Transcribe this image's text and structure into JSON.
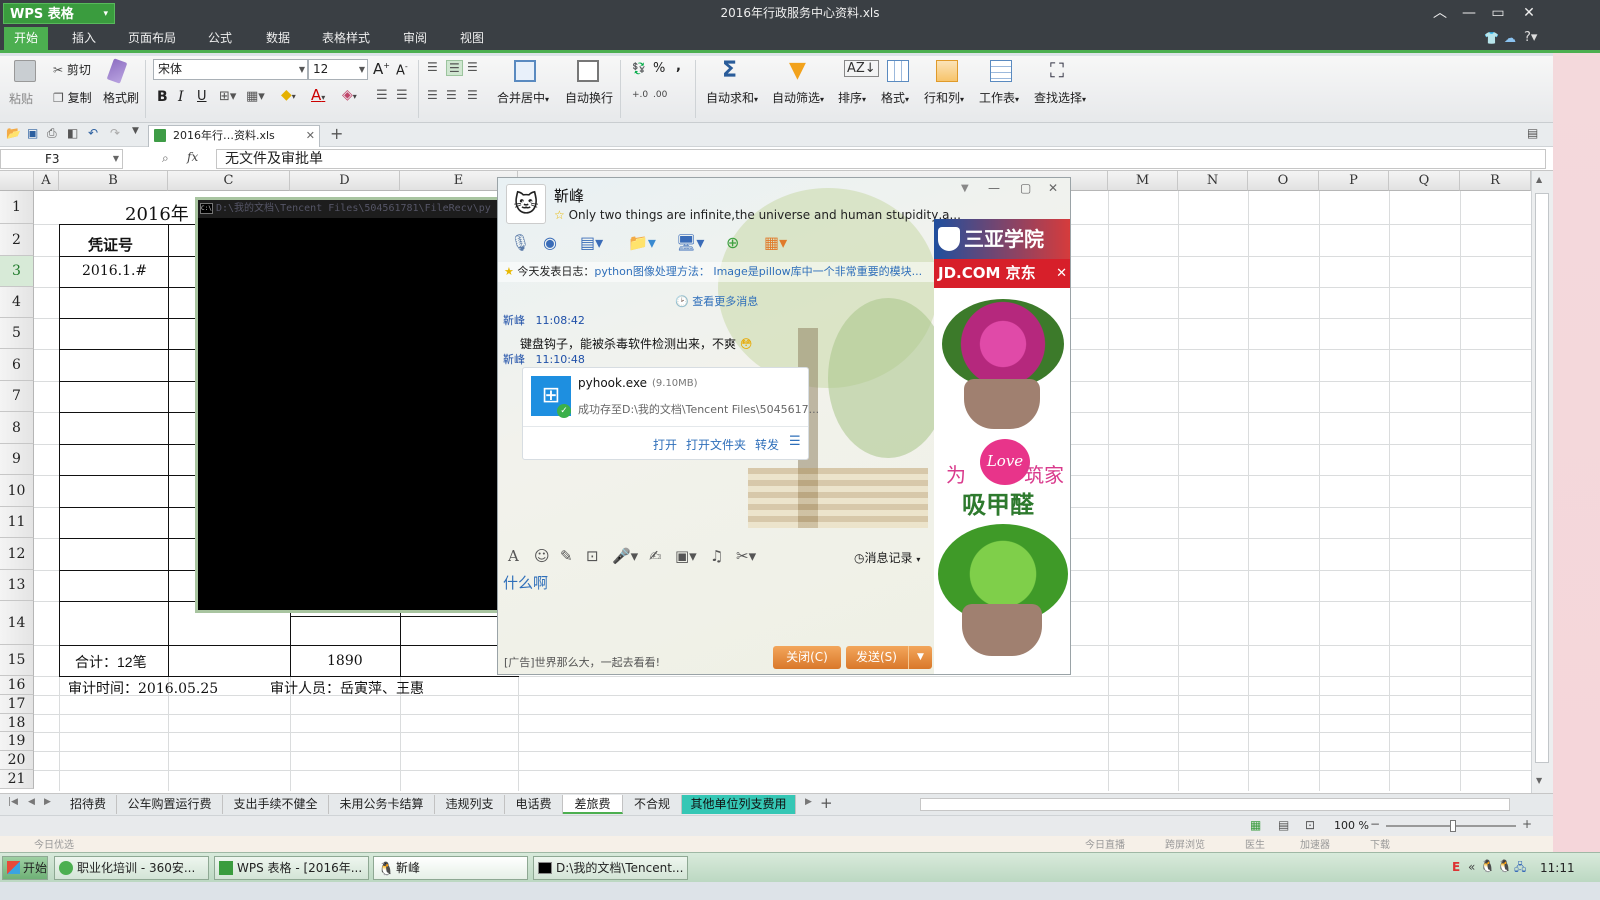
{
  "app": {
    "logo": "WPS 表格",
    "title": "2016年行政服务中心资料.xls"
  },
  "menu": [
    "开始",
    "插入",
    "页面布局",
    "公式",
    "数据",
    "表格样式",
    "审阅",
    "视图"
  ],
  "ribbon": {
    "paste": "粘贴",
    "cut": "剪切",
    "copy": "复制",
    "format_painter": "格式刷",
    "font_name": "宋体",
    "font_size": "12",
    "merge_center": "合并居中",
    "wrap": "自动换行",
    "autosum": "自动求和",
    "autofilter": "自动筛选",
    "sort": "排序",
    "format": "格式",
    "rows_cols": "行和列",
    "worksheet": "工作表",
    "find_select": "查找选择",
    "percent": "%",
    "comma": ","
  },
  "doc_tab": "2016年行…资料.xls",
  "formula_bar": {
    "cell_ref": "F3",
    "fx": "fx",
    "content": "无文件及审批单"
  },
  "columns": [
    "A",
    "B",
    "C",
    "D",
    "E",
    "M",
    "N",
    "O",
    "P",
    "Q",
    "R"
  ],
  "rows": [
    "1",
    "2",
    "3",
    "4",
    "5",
    "6",
    "7",
    "8",
    "9",
    "10",
    "11",
    "12",
    "13",
    "14",
    "15",
    "16",
    "17",
    "18",
    "19",
    "20",
    "21"
  ],
  "cells": {
    "b1": "2016年",
    "b2": "凭证号",
    "b3": "2016.1.#",
    "b15": "合计：12笔",
    "d15": "1890",
    "b16": "审计时间：2016.05.25",
    "d16": "审计人员：岳寅萍、王惠"
  },
  "cmd": {
    "title": "D:\\我的文档\\Tencent Files\\504561781\\FileRecv\\py"
  },
  "qq": {
    "contact": "靳峰",
    "signature": "Only two things are infinite,the universe and human stupidity,a...",
    "log_label": "今天发表日志：",
    "log_text": "python图像处理方法： Image是pillow库中一个非常重要的模块...",
    "more_messages": "查看更多消息",
    "msg1_sender": "靳峰",
    "msg1_time": "11:08:42",
    "msg1_text": "键盘钩子，能被杀毒软件检测出来，不爽",
    "msg2_sender": "靳峰",
    "msg2_time": "11:10:48",
    "file_name": "pyhook.exe",
    "file_size": "(9.10MB)",
    "file_saved": "成功存至D:\\我的文档\\Tencent Files\\5045617...",
    "open": "打开",
    "open_folder": "打开文件夹",
    "forward": "转发",
    "history": "消息记录",
    "draft": "什么啊",
    "ad_text": "[广告]世界那么大，一起去看看!",
    "close": "关闭(C)",
    "send": "发送(S)",
    "ad_school": "三亚学院",
    "ad_jd": "JD.COM 京东",
    "ad_love": "Love",
    "ad_slogan1": "为",
    "ad_slogan2": "筑家",
    "ad_slogan3": "吸甲醛"
  },
  "sheet_tabs": [
    "招待费",
    "公车购置运行费",
    "支出手续不健全",
    "未用公务卡结算",
    "违规列支",
    "电话费",
    "差旅费",
    "不合规",
    "其他单位列支费用"
  ],
  "status": {
    "zoom": "100 %",
    "left_text": "今日优选",
    "right_items": [
      "今日直播",
      "跨屏浏览",
      "医生",
      "加速器",
      "下载"
    ]
  },
  "taskbar": {
    "start": "开始",
    "items": [
      "职业化培训 - 360安...",
      "WPS 表格 - [2016年...",
      "靳峰",
      "D:\\我的文档\\Tencent..."
    ],
    "clock": "11:11"
  },
  "colors": {
    "accent": "#4caf50",
    "titlebar": "#3a3f44",
    "qq_link": "#2f6fba"
  }
}
